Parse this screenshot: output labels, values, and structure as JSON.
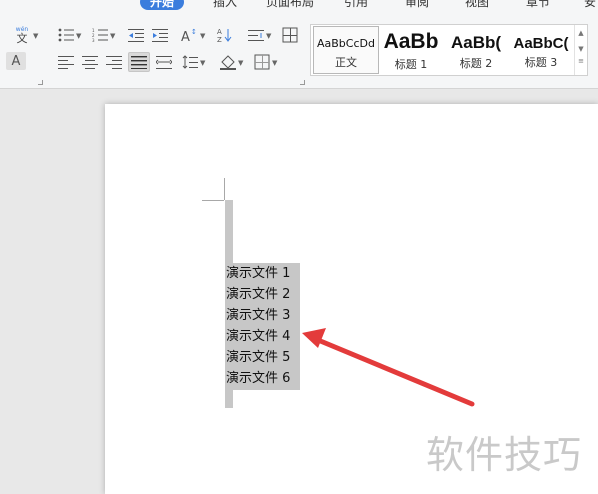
{
  "tabs": [
    "开始",
    "插入",
    "页面布局",
    "引用",
    "审阅",
    "视图",
    "章节",
    "安"
  ],
  "ribbon": {
    "phonetic_label": "wén",
    "phonetic_char": "文",
    "char_shading_label": "A",
    "style_gallery": [
      {
        "sample": "AaBbCcDd",
        "name": "正文"
      },
      {
        "sample": "AaBb",
        "name": "标题 1"
      },
      {
        "sample": "AaBb(",
        "name": "标题 2"
      },
      {
        "sample": "AaBbC(",
        "name": "标题 3"
      }
    ]
  },
  "document": {
    "lines": [
      "演示文件 1",
      "演示文件 2",
      "演示文件 3",
      "演示文件 4",
      "演示文件 5",
      "演示文件 6"
    ]
  },
  "watermark": "软件技巧",
  "colors": {
    "accent": "#3b7ddd",
    "arrow": "#e33b3b",
    "selection": "#c7c7c7"
  }
}
